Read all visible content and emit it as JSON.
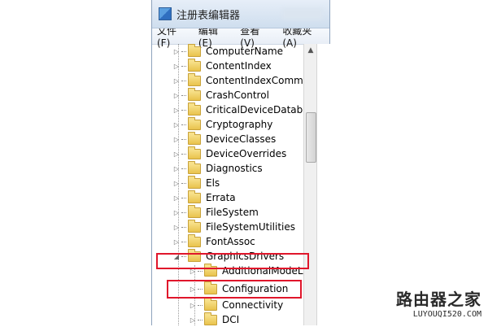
{
  "window": {
    "title": "注册表编辑器"
  },
  "menubar": {
    "items": [
      {
        "label": "文件(F)"
      },
      {
        "label": "编辑(E)"
      },
      {
        "label": "查看(V)"
      },
      {
        "label": "收藏夹(A)"
      }
    ]
  },
  "tree": {
    "items": [
      {
        "label": "ComputerName"
      },
      {
        "label": "ContentIndex"
      },
      {
        "label": "ContentIndexCommon"
      },
      {
        "label": "CrashControl"
      },
      {
        "label": "CriticalDeviceDatabase"
      },
      {
        "label": "Cryptography"
      },
      {
        "label": "DeviceClasses"
      },
      {
        "label": "DeviceOverrides"
      },
      {
        "label": "Diagnostics"
      },
      {
        "label": "Els"
      },
      {
        "label": "Errata"
      },
      {
        "label": "FileSystem"
      },
      {
        "label": "FileSystemUtilities"
      },
      {
        "label": "FontAssoc"
      },
      {
        "label": "GraphicsDrivers"
      },
      {
        "label": "AdditionalModeLists"
      },
      {
        "label": "Configuration"
      },
      {
        "label": "Connectivity"
      },
      {
        "label": "DCI"
      }
    ]
  },
  "watermark": {
    "name": "路由器之家",
    "url": "LUYOUQI520.COM"
  },
  "colors": {
    "highlight": "#e0162b",
    "folder": "#e9c34d"
  }
}
